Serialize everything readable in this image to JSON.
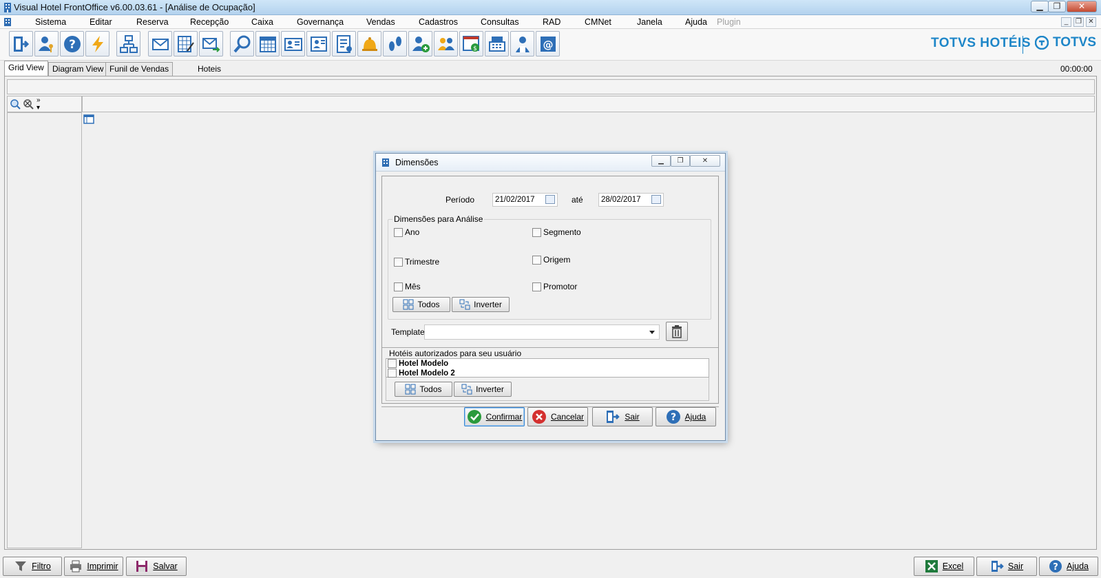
{
  "window": {
    "title": "Visual Hotel FrontOffice v6.00.03.61 - [Análise de Ocupação]"
  },
  "menu": {
    "items": [
      "Sistema",
      "Editar",
      "Reserva",
      "Recepção",
      "Caixa",
      "Governança",
      "Vendas",
      "Cadastros",
      "Consultas",
      "RAD",
      "CMNet",
      "Janela",
      "Ajuda"
    ],
    "disabled_item": "Plugin"
  },
  "toolbar": {
    "icons": [
      "exit-icon",
      "user-key-icon",
      "help-icon",
      "lightning-icon",
      "network-icon",
      "mail-icon",
      "grid-edit-icon",
      "mail-forward-icon",
      "search-icon",
      "calendar-icon",
      "contact-card-icon",
      "id-card-icon",
      "checklist-icon",
      "bell-icon",
      "footprints-icon",
      "add-user-icon",
      "group-icon",
      "money-report-icon",
      "cash-register-icon",
      "housekeeper-icon",
      "email-at-icon"
    ]
  },
  "brand": {
    "hotels": "TOTVS HOTÉIS",
    "totvs": "TOTVS",
    "color": "#1e86c8"
  },
  "tabs": {
    "grid": "Grid View",
    "diagram": "Diagram View",
    "funil": "Funil de Vendas",
    "hoteis": "Hoteis",
    "clock": "00:00:00"
  },
  "dialog": {
    "title": "Dimensões",
    "periodo_label": "Período",
    "data_inicio": "21/02/2017",
    "ate_label": "até",
    "data_fim": "28/02/2017",
    "dimensoes_title": "Dimensões para Análise",
    "dimensoes": {
      "ano": "Ano",
      "trimestre": "Trimestre",
      "mes": "Mês",
      "segmento": "Segmento",
      "origem": "Origem",
      "promotor": "Promotor"
    },
    "todos_label": "Todos",
    "inverter_label": "Inverter",
    "template_label": "Template",
    "template_value": "",
    "hoteis_title": "Hotéis autorizados para seu usuário",
    "hoteis": [
      "Hotel Modelo",
      "Hotel Modelo 2"
    ],
    "confirmar": "Confirmar",
    "cancelar": "Cancelar",
    "sair": "Sair",
    "ajuda": "Ajuda"
  },
  "statusbar": {
    "filtro": "Filtro",
    "imprimir": "Imprimir",
    "salvar": "Salvar",
    "excel": "Excel",
    "sair": "Sair",
    "ajuda": "Ajuda"
  }
}
